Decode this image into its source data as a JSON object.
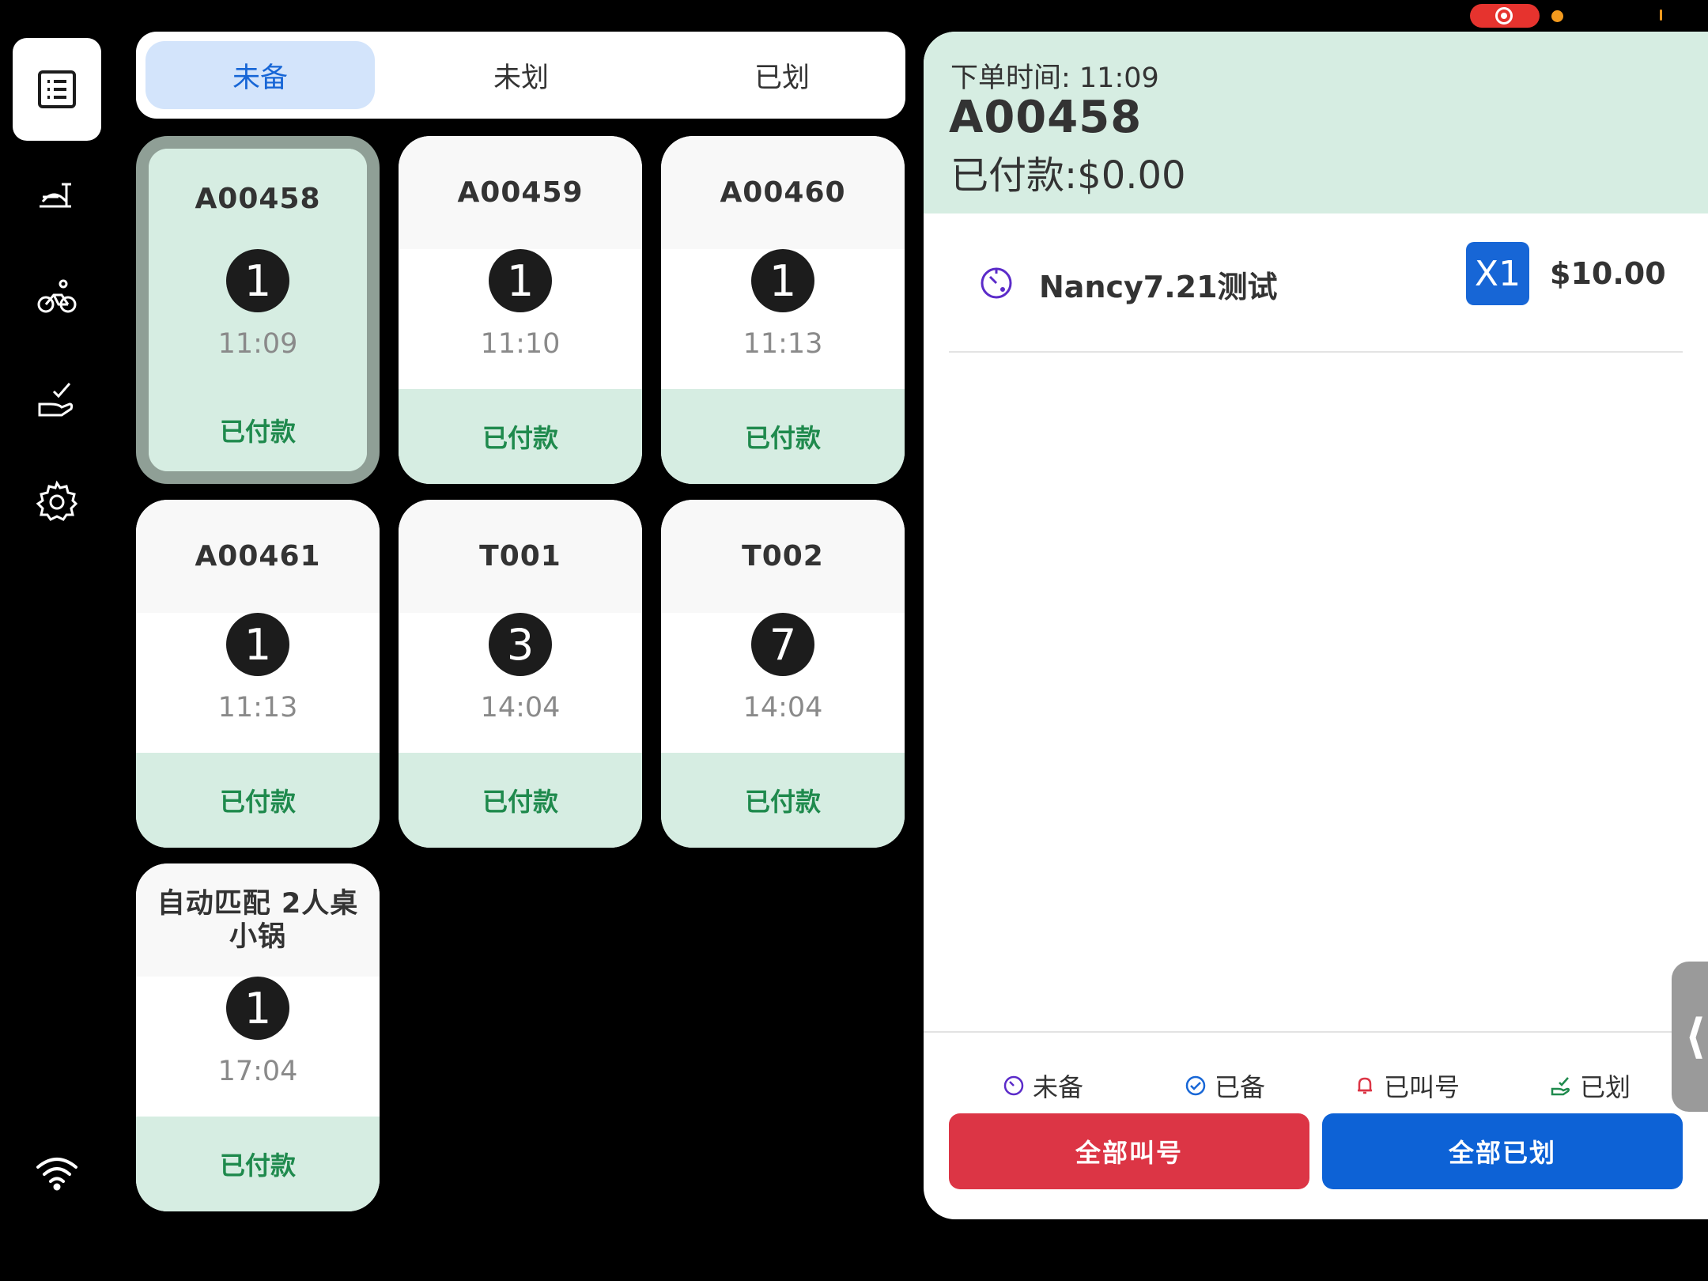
{
  "sidebar": {
    "items": [
      {
        "name": "orders",
        "icon": "order-list-icon",
        "active": true
      },
      {
        "name": "serve",
        "icon": "food-tray-icon",
        "active": false
      },
      {
        "name": "delivery",
        "icon": "bicycle-icon",
        "active": false
      },
      {
        "name": "done",
        "icon": "hand-check-icon",
        "active": false
      },
      {
        "name": "settings",
        "icon": "gear-icon",
        "active": false
      }
    ],
    "network_icon": "wifi-icon"
  },
  "tabs": [
    {
      "label": "未备",
      "active": true
    },
    {
      "label": "未划",
      "active": false
    },
    {
      "label": "已划",
      "active": false
    }
  ],
  "orders": [
    {
      "id": "A00458",
      "count": "1",
      "time": "11:09",
      "status": "已付款",
      "selected": true
    },
    {
      "id": "A00459",
      "count": "1",
      "time": "11:10",
      "status": "已付款",
      "selected": false
    },
    {
      "id": "A00460",
      "count": "1",
      "time": "11:13",
      "status": "已付款",
      "selected": false
    },
    {
      "id": "A00461",
      "count": "1",
      "time": "11:13",
      "status": "已付款",
      "selected": false
    },
    {
      "id": "T001",
      "count": "3",
      "time": "14:04",
      "status": "已付款",
      "selected": false
    },
    {
      "id": "T002",
      "count": "7",
      "time": "14:04",
      "status": "已付款",
      "selected": false
    },
    {
      "id_line1": "自动匹配 2人桌",
      "id_line2": "小锅",
      "count": "1",
      "time": "17:04",
      "status": "已付款",
      "selected": false
    }
  ],
  "detail": {
    "order_time": "下单时间: 11:09",
    "order_id": "A00458",
    "paid": "已付款:$0.00",
    "items": [
      {
        "name": "Nancy7.21测试",
        "qty": "X1",
        "price": "$10.00",
        "state_icon": "timer-icon"
      }
    ],
    "legend": [
      {
        "label": "未备",
        "icon": "timer-icon"
      },
      {
        "label": "已备",
        "icon": "check-circle-icon"
      },
      {
        "label": "已叫号",
        "icon": "bell-icon"
      },
      {
        "label": "已划",
        "icon": "hand-check-icon"
      }
    ],
    "buttons": {
      "call_all": "全部叫号",
      "mark_all": "全部已划"
    }
  },
  "colors": {
    "accent_blue": "#1766d6",
    "paid_green": "#1f8a4d",
    "panel_green": "#d6ede2",
    "danger_red": "#dc3545"
  }
}
